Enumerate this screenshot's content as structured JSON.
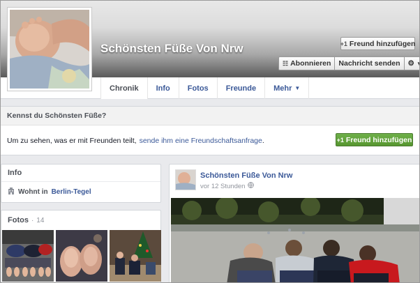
{
  "header": {
    "page_name": "Schönsten Füße Von Nrw",
    "add_friend_label": "Freund hinzufügen",
    "subscribe_label": "Abonnieren",
    "message_label": "Nachricht senden",
    "icons": {
      "add_friend": "add-friend-icon",
      "rss": "rss-icon",
      "gear": "gear-icon"
    }
  },
  "tabs": [
    {
      "label": "Chronik"
    },
    {
      "label": "Info"
    },
    {
      "label": "Fotos"
    },
    {
      "label": "Freunde"
    },
    {
      "label": "Mehr"
    }
  ],
  "know_box": {
    "title": "Kennst du Schönsten Füße?",
    "text": "Um zu sehen, was er mit Freunden teilt,",
    "link": "sende ihm eine Freundschaftsanfrage",
    "suffix": ".",
    "button_label": "Freund hinzufügen"
  },
  "info_box": {
    "title": "Info",
    "lives_label": "Wohnt in",
    "location": "Berlin-Tegel"
  },
  "photos_box": {
    "title": "Fotos",
    "separator": " · ",
    "count": "14"
  },
  "post": {
    "author": "Schönsten Füße Von Nrw",
    "time": "vor 12 Stunden"
  },
  "colors": {
    "link": "#3b5998",
    "green_button": "#5ba238",
    "background": "#e9eaed"
  }
}
